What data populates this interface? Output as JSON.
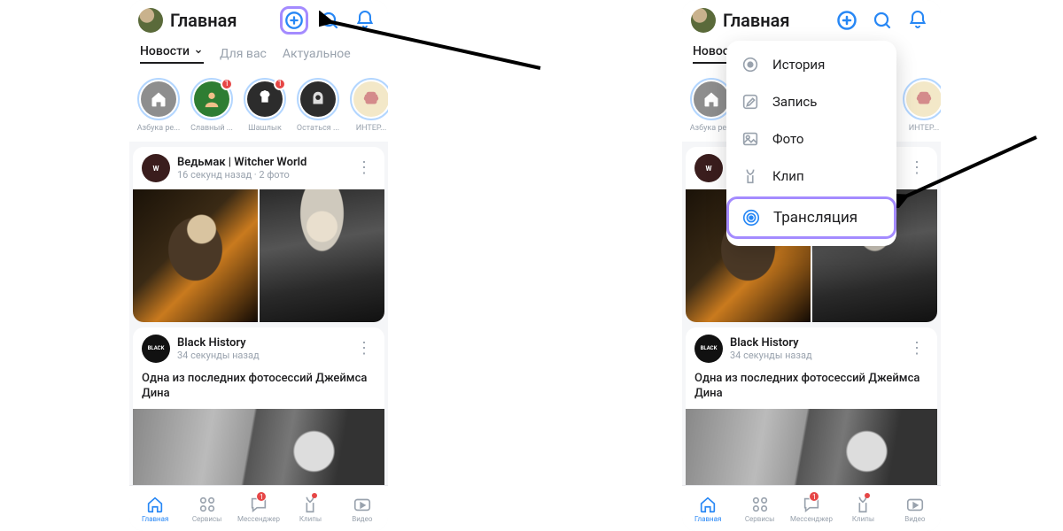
{
  "header": {
    "title": "Главная"
  },
  "tabs": {
    "news": "Новости",
    "for_you": "Для вас",
    "trending": "Актуальное"
  },
  "stories": [
    {
      "label": "Азбука ре...",
      "bg": "#8e8e8e",
      "icon": "house",
      "badge": null
    },
    {
      "label": "Славный ...",
      "bg": "#2e7d32",
      "icon": "person",
      "badge": "1"
    },
    {
      "label": "Шашлык",
      "bg": "#2c2c2c",
      "icon": "chef",
      "badge": "1"
    },
    {
      "label": "Остаться ...",
      "bg": "#2c2c2c",
      "icon": "hood",
      "badge": null
    },
    {
      "label": "ИНТЕР...",
      "bg": "#f3e8c8",
      "icon": "brain",
      "badge": null
    }
  ],
  "posts": [
    {
      "name": "Ведьмак | Witcher World",
      "time": "16 секунд назад · 2 фото",
      "avatar_bg": "#3a1d1d",
      "avatar_text": "W"
    },
    {
      "name": "Black History",
      "time": "34 секунды назад",
      "avatar_bg": "#111",
      "avatar_text": "BLACK",
      "text": "Одна из последних фотосессий Джеймса Дина"
    }
  ],
  "bottom": [
    {
      "label": "Главная",
      "icon": "home",
      "active": true
    },
    {
      "label": "Сервисы",
      "icon": "services"
    },
    {
      "label": "Мессенджер",
      "icon": "msg",
      "badge": "1"
    },
    {
      "label": "Клипы",
      "icon": "clips",
      "reddot": true
    },
    {
      "label": "Видео",
      "icon": "video"
    }
  ],
  "popup": [
    {
      "label": "История",
      "icon": "story"
    },
    {
      "label": "Запись",
      "icon": "post"
    },
    {
      "label": "Фото",
      "icon": "photo"
    },
    {
      "label": "Клип",
      "icon": "clip"
    },
    {
      "label": "Трансляция",
      "icon": "live",
      "highlight": true
    }
  ]
}
